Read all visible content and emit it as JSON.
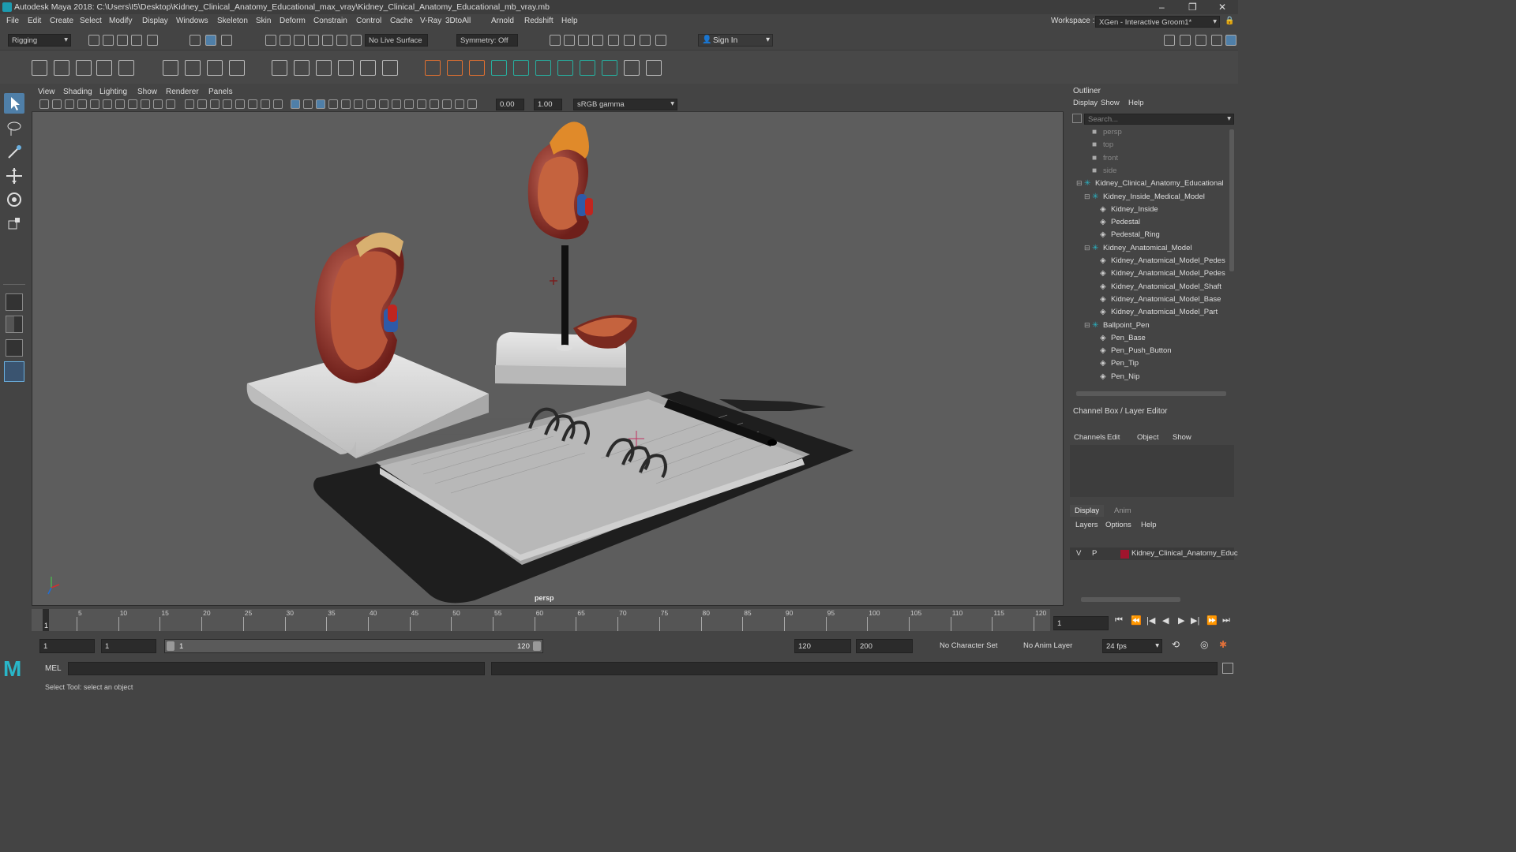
{
  "window": {
    "title": "Autodesk Maya 2018: C:\\Users\\I5\\Desktop\\Kidney_Clinical_Anatomy_Educational_max_vray\\Kidney_Clinical_Anatomy_Educational_mb_vray.mb",
    "workspace_label": "Workspace :",
    "workspace_value": "XGen - Interactive Groom1*"
  },
  "menu": [
    "File",
    "Edit",
    "Create",
    "Select",
    "Modify",
    "Display",
    "Windows",
    "Skeleton",
    "Skin",
    "Deform",
    "Constrain",
    "Control",
    "Cache",
    "V-Ray",
    "3DtoAll",
    "Arnold",
    "Redshift",
    "Help"
  ],
  "statusline": {
    "mode": "Rigging",
    "live_surface": "No Live Surface",
    "symmetry": "Symmetry: Off",
    "sign_in": "Sign In"
  },
  "viewport": {
    "menu": [
      "View",
      "Shading",
      "Lighting",
      "Show",
      "Renderer",
      "Panels"
    ],
    "exposure": "0.00",
    "gamma": "1.00",
    "color_space": "sRGB gamma",
    "camera_label": "persp"
  },
  "outliner": {
    "title": "Outliner",
    "menu": [
      "Display",
      "Show",
      "Help"
    ],
    "search_placeholder": "Search...",
    "items": [
      {
        "label": "persp",
        "indent": 0,
        "kind": "camera",
        "dim": true
      },
      {
        "label": "top",
        "indent": 0,
        "kind": "camera",
        "dim": true
      },
      {
        "label": "front",
        "indent": 0,
        "kind": "camera",
        "dim": true
      },
      {
        "label": "side",
        "indent": 0,
        "kind": "camera",
        "dim": true
      },
      {
        "label": "Kidney_Clinical_Anatomy_Educational",
        "indent": 0,
        "kind": "group",
        "expanded": true
      },
      {
        "label": "Kidney_Inside_Medical_Model",
        "indent": 1,
        "kind": "group",
        "expanded": true
      },
      {
        "label": "Kidney_Inside",
        "indent": 2,
        "kind": "mesh"
      },
      {
        "label": "Pedestal",
        "indent": 2,
        "kind": "mesh"
      },
      {
        "label": "Pedestal_Ring",
        "indent": 2,
        "kind": "mesh"
      },
      {
        "label": "Kidney_Anatomical_Model",
        "indent": 1,
        "kind": "group",
        "expanded": true
      },
      {
        "label": "Kidney_Anatomical_Model_Pedes",
        "indent": 2,
        "kind": "mesh"
      },
      {
        "label": "Kidney_Anatomical_Model_Pedes",
        "indent": 2,
        "kind": "mesh"
      },
      {
        "label": "Kidney_Anatomical_Model_Shaft",
        "indent": 2,
        "kind": "mesh"
      },
      {
        "label": "Kidney_Anatomical_Model_Base",
        "indent": 2,
        "kind": "mesh"
      },
      {
        "label": "Kidney_Anatomical_Model_Part",
        "indent": 2,
        "kind": "mesh"
      },
      {
        "label": "Ballpoint_Pen",
        "indent": 1,
        "kind": "group",
        "expanded": true
      },
      {
        "label": "Pen_Base",
        "indent": 2,
        "kind": "mesh"
      },
      {
        "label": "Pen_Push_Button",
        "indent": 2,
        "kind": "mesh"
      },
      {
        "label": "Pen_Tip",
        "indent": 2,
        "kind": "mesh"
      },
      {
        "label": "Pen_Nip",
        "indent": 2,
        "kind": "mesh"
      }
    ]
  },
  "channelbox": {
    "title": "Channel Box / Layer Editor",
    "menu": [
      "Channels",
      "Edit",
      "Object",
      "Show"
    ],
    "tabs": [
      "Display",
      "Anim"
    ],
    "layer_menu": [
      "Layers",
      "Options",
      "Help"
    ],
    "layer": {
      "v": "V",
      "p": "P",
      "name": "Kidney_Clinical_Anatomy_Educ",
      "color": "#a0142d"
    }
  },
  "timeline": {
    "ticks": [
      "5",
      "10",
      "15",
      "20",
      "25",
      "30",
      "35",
      "40",
      "45",
      "50",
      "55",
      "60",
      "65",
      "70",
      "75",
      "80",
      "85",
      "90",
      "95",
      "100",
      "105",
      "110",
      "115",
      "120"
    ],
    "start_marker": "1",
    "current_frame": "1"
  },
  "range": {
    "start": "1",
    "anim_start": "1",
    "slider_start": "1",
    "slider_end": "120",
    "anim_end": "120",
    "end": "200",
    "character_set": "No Character Set",
    "anim_layer": "No Anim Layer",
    "fps": "24 fps"
  },
  "cmdline": {
    "lang": "MEL"
  },
  "help": {
    "text": "Select Tool: select an object"
  },
  "colors": {
    "accent": "#4f7fa8",
    "layer": "#a0142d",
    "maya_logo": "#29b6c8"
  }
}
